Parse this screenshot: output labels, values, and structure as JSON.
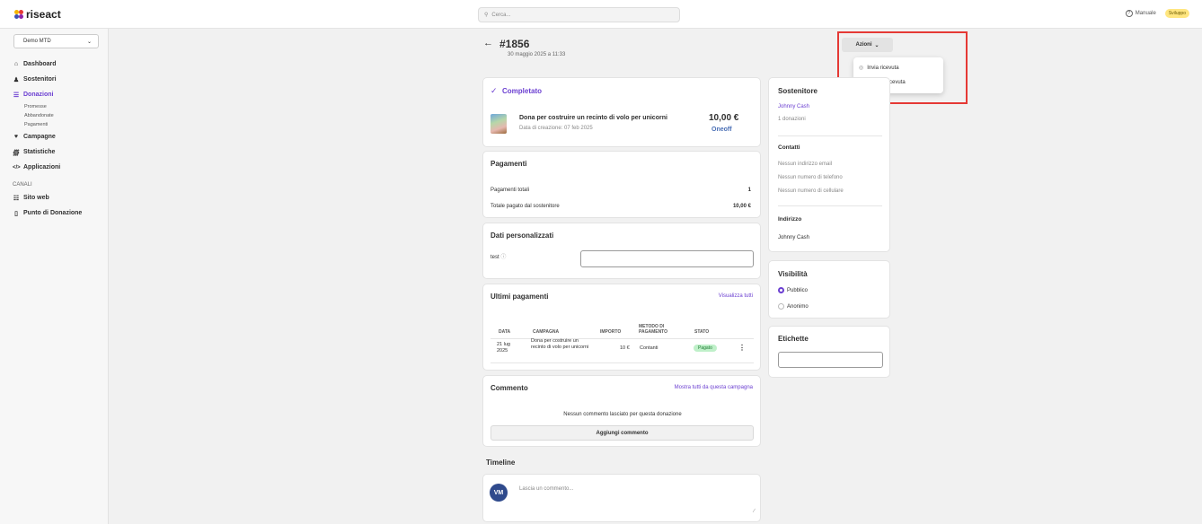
{
  "header": {
    "logo_text": "riseact",
    "search_placeholder": "Cerca...",
    "manual_label": "Manuale",
    "env_badge": "Sviluppo",
    "colors": {
      "accent": "#6b3fd1",
      "badge_bg": "#ffe680"
    }
  },
  "sidebar": {
    "store_name": "Demo MTD",
    "items": [
      {
        "label": "Dashboard",
        "icon": "home-icon"
      },
      {
        "label": "Sostenitori",
        "icon": "user-icon"
      },
      {
        "label": "Donazioni",
        "icon": "list-icon",
        "active": true
      },
      {
        "label": "Campagne",
        "icon": "heart-icon"
      },
      {
        "label": "Statistiche",
        "icon": "chart-icon"
      },
      {
        "label": "Applicazioni",
        "icon": "code-icon"
      }
    ],
    "donation_sub": [
      "Promesse",
      "Abbandonate",
      "Pagamenti"
    ],
    "channels_title": "CANALI",
    "channels": [
      {
        "label": "Sito web",
        "icon": "globe-icon"
      },
      {
        "label": "Punto di Donazione",
        "icon": "device-icon"
      }
    ]
  },
  "order": {
    "number": "#1856",
    "date": "30 maggio 2025 a 11:33",
    "actions_label": "Azioni",
    "actions_menu": [
      "Invia ricevuta",
      "Scarica ricevuta"
    ]
  },
  "status_card": {
    "status": "Completato",
    "product_title": "Dona per costruire un recinto di volo per unicorni",
    "created": "Data di creazione: 07 feb 2025",
    "amount": "10,00 €",
    "frequency": "Oneoff"
  },
  "payments_card": {
    "title": "Pagamenti",
    "total_payments_label": "Pagamenti totali",
    "total_payments_value": "1",
    "total_paid_label": "Totale pagato dal sostenitore",
    "total_paid_value": "10,00 €"
  },
  "custom_data_card": {
    "title": "Dati personalizzati",
    "field_label": "test"
  },
  "last_payments_card": {
    "title": "Ultimi pagamenti",
    "view_all": "Visualizza tutti",
    "headers": [
      "DATA",
      "CAMPAGNA",
      "IMPORTO",
      "METODO DI PAGAMENTO",
      "STATO"
    ],
    "rows": [
      {
        "date": "21 lug 2025",
        "campaign": "Dona per costruire un recinto di volo per unicorni",
        "amount": "10 €",
        "method": "Contanti",
        "status": "Pagato"
      }
    ]
  },
  "comment_card": {
    "title": "Commento",
    "show_all": "Mostra tutti da questa campagna",
    "empty": "Nessun commento lasciato per questa donazione",
    "add_button": "Aggiungi commento"
  },
  "timeline": {
    "title": "Timeline",
    "avatar_initials": "VM",
    "comment_placeholder": "Lascia un commento..."
  },
  "supporter_card": {
    "title": "Sostenitore",
    "name": "Johnny Cash",
    "donations": "1 donazioni",
    "contacts_title": "Contatti",
    "no_email": "Nessun indirizzo email",
    "no_phone": "Nessun numero di telefono",
    "no_mobile": "Nessun numero di cellulare",
    "address_title": "Indirizzo",
    "address_name": "Johnny Cash"
  },
  "visibility_card": {
    "title": "Visibilità",
    "options": [
      "Pubblico",
      "Anonimo"
    ],
    "selected": "Pubblico"
  },
  "tags_card": {
    "title": "Etichette"
  }
}
